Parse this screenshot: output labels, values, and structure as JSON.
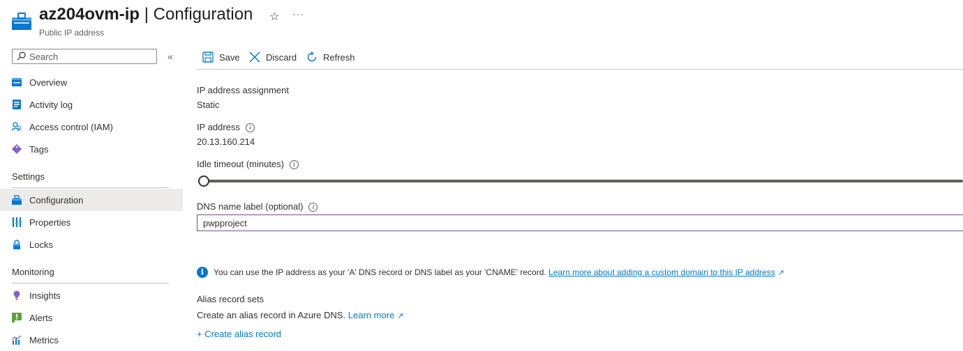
{
  "header": {
    "resource_name": "az204ovm-ip",
    "separator": " | ",
    "blade": "Configuration",
    "subtitle": "Public IP address",
    "favorite_icon": "star-icon",
    "more_icon": "ellipsis-icon"
  },
  "sidebar": {
    "search_placeholder": "Search",
    "items_top": [
      {
        "label": "Overview",
        "icon": "overview-icon"
      },
      {
        "label": "Activity log",
        "icon": "activity-log-icon"
      },
      {
        "label": "Access control (IAM)",
        "icon": "iam-icon"
      },
      {
        "label": "Tags",
        "icon": "tag-icon"
      }
    ],
    "settings_header": "Settings",
    "items_settings": [
      {
        "label": "Configuration",
        "icon": "configuration-icon",
        "active": true
      },
      {
        "label": "Properties",
        "icon": "properties-icon"
      },
      {
        "label": "Locks",
        "icon": "lock-icon"
      }
    ],
    "monitoring_header": "Monitoring",
    "items_monitoring": [
      {
        "label": "Insights",
        "icon": "insights-icon"
      },
      {
        "label": "Alerts",
        "icon": "alerts-icon"
      },
      {
        "label": "Metrics",
        "icon": "metrics-icon"
      }
    ]
  },
  "toolbar": {
    "save": "Save",
    "discard": "Discard",
    "refresh": "Refresh"
  },
  "form": {
    "assignment_label": "IP address assignment",
    "assignment_value": "Static",
    "ip_label": "IP address",
    "ip_value": "20.13.160.214",
    "idle_label": "Idle timeout (minutes)",
    "idle_value": 4,
    "idle_min": 4,
    "idle_max": 30,
    "dns_label": "DNS name label (optional)",
    "dns_value": "pwpproject"
  },
  "info": {
    "text": "You can use the IP address as your 'A' DNS record or DNS label as your 'CNAME' record.",
    "link": "Learn more about adding a custom domain to this IP address"
  },
  "alias": {
    "title": "Alias record sets",
    "text": "Create an alias record in Azure DNS.",
    "learn_more": "Learn more",
    "create": "+ Create alias record"
  },
  "colors": {
    "accent": "#0078d4",
    "input_border": "#7a4b88",
    "active_bg": "#edebe9"
  }
}
